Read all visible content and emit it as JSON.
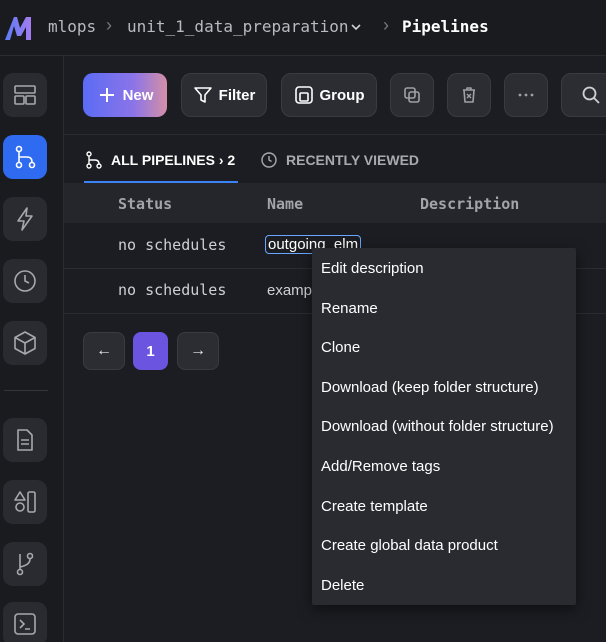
{
  "breadcrumb": {
    "workspace": "mlops",
    "project": "unit_1_data_preparation",
    "page": "Pipelines"
  },
  "toolbar": {
    "new_label": "New",
    "filter_label": "Filter",
    "group_label": "Group"
  },
  "tabs": {
    "all_label": "ALL PIPELINES",
    "all_count": "› 2",
    "recent_label": "RECENTLY VIEWED"
  },
  "table": {
    "headers": [
      "Status",
      "Name",
      "Description"
    ],
    "rows": [
      {
        "status": "no schedules",
        "name": "outgoing_elm"
      },
      {
        "status": "no schedules",
        "name": "examp"
      }
    ]
  },
  "pagination": {
    "current_page": "1",
    "prev_glyph": "←",
    "next_glyph": "→"
  },
  "context_menu": {
    "items": [
      "Edit description",
      "Rename",
      "Clone",
      "Download (keep folder structure)",
      "Download (without folder structure)",
      "Add/Remove tags",
      "Create template",
      "Create global data product",
      "Delete"
    ]
  },
  "colors": {
    "active_nav": "#2e6bf0",
    "tab_underline": "#3b82f6",
    "current_page": "#6b54e0"
  }
}
